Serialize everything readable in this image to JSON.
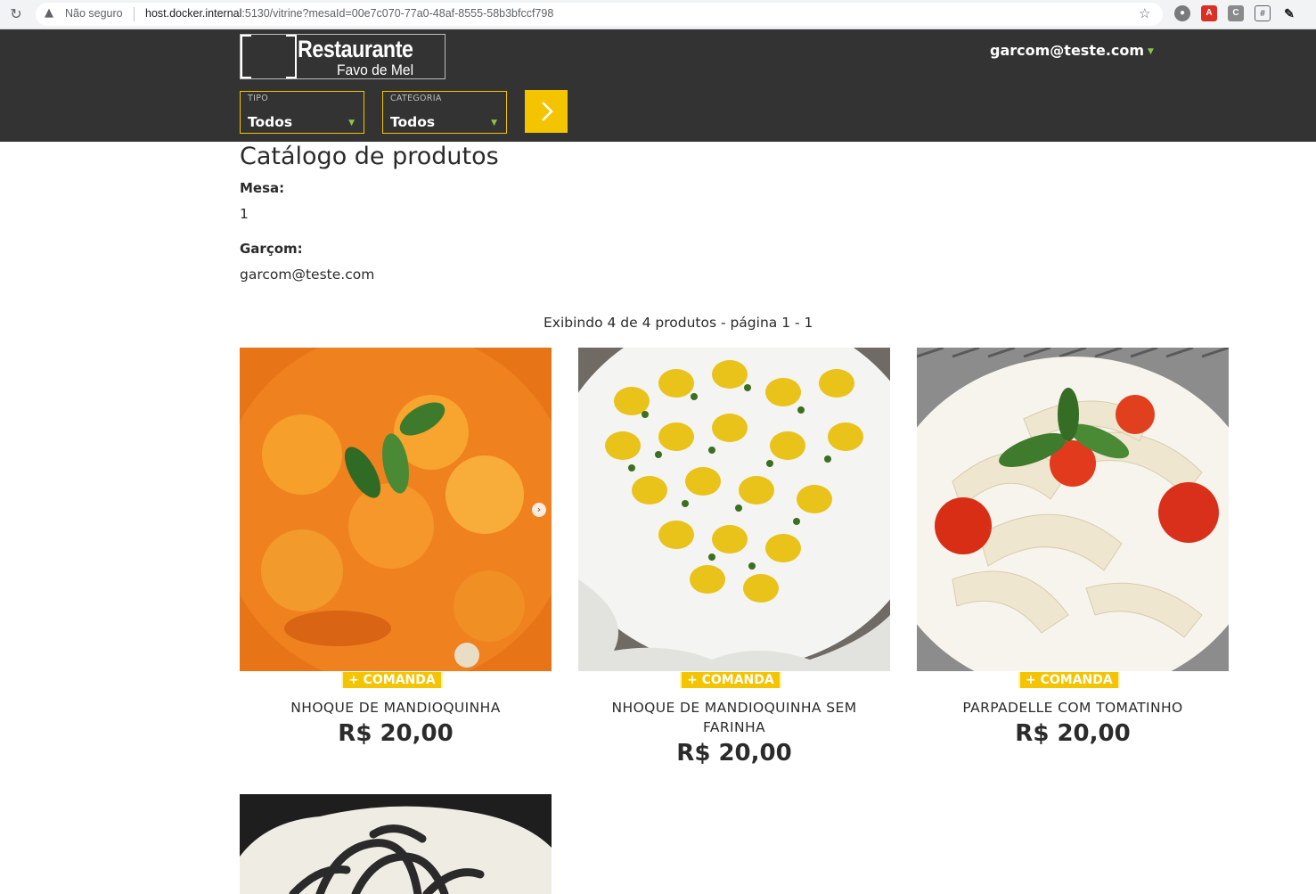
{
  "browser": {
    "security_label": "Não seguro",
    "url_host": "host.docker.internal",
    "url_rest": ":5130/vitrine?mesaId=00e7c070-77a0-48af-8555-58b3bfccf798"
  },
  "header": {
    "logo_title": "Restaurante",
    "logo_subtitle": "Favo de Mel",
    "user_email": "garcom@teste.com",
    "filters": [
      {
        "label": "TIPO",
        "value": "Todos"
      },
      {
        "label": "CATEGORIA",
        "value": "Todos"
      }
    ]
  },
  "main": {
    "title": "Catálogo de produtos",
    "mesa_label": "Mesa:",
    "mesa_value": "1",
    "garcom_label": "Garçom:",
    "garcom_value": "garcom@teste.com",
    "results_summary": "Exibindo 4 de 4 produtos - página 1 - 1"
  },
  "products": [
    {
      "name": "NHOQUE DE MANDIOQUINHA",
      "price": "R$ 20,00",
      "add_label": "+ COMANDA",
      "image": "orange-gnocchi-photo"
    },
    {
      "name": "NHOQUE DE MANDIOQUINHA SEM FARINHA",
      "price": "R$ 20,00",
      "add_label": "+ COMANDA",
      "image": "yellow-gnocchi-photo"
    },
    {
      "name": "PARPADELLE COM TOMATINHO",
      "price": "R$ 20,00",
      "add_label": "+ COMANDA",
      "image": "pappardelle-tomato-photo"
    },
    {
      "name": "",
      "price": "",
      "add_label": "",
      "image": "black-pasta-photo"
    }
  ],
  "colors": {
    "header_bg": "#333333",
    "accent": "#f5c400",
    "caret": "#8bc34a"
  }
}
